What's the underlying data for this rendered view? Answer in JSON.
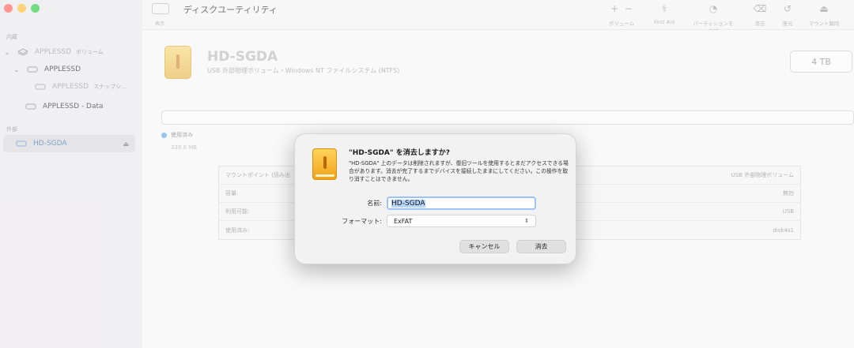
{
  "window": {
    "title": "ディスクユーティリティ",
    "view_label": "表示"
  },
  "toolbar": {
    "buttons": [
      {
        "label": "ボリューム",
        "icon": "plus-minus-icon"
      },
      {
        "label": "First Aid",
        "icon": "stethoscope-icon"
      },
      {
        "label": "パーティションを作成",
        "icon": "partition-icon"
      },
      {
        "label": "消去",
        "icon": "erase-icon"
      },
      {
        "label": "復元",
        "icon": "restore-icon"
      },
      {
        "label": "マウント解除",
        "icon": "eject-icon"
      }
    ]
  },
  "sidebar": {
    "section_internal": "内蔵",
    "section_external": "外部",
    "items": [
      {
        "label": "APPLESSD",
        "sub": "ボリューム"
      },
      {
        "label": "APPLESSD",
        "sub": ""
      },
      {
        "label": "APPLESSD",
        "sub": "スナップシ…"
      },
      {
        "label": "APPLESSD - Data",
        "sub": ""
      },
      {
        "label": "HD-SGDA",
        "sub": ""
      }
    ]
  },
  "main": {
    "disk_name": "HD-SGDA",
    "disk_desc": "USB 外部物理ボリューム・Windows NT ファイルシステム (NTFS)",
    "capacity": "4 TB",
    "used_label": "使用済み",
    "used_value": "339.6 MB",
    "info_rows": [
      {
        "left": "マウントポイント (読み出",
        "right": "USB 外部物理ボリューム"
      },
      {
        "left": "容量:",
        "right": "無効"
      },
      {
        "left": "利用可能:",
        "right": "USB"
      },
      {
        "left": "使用済み:",
        "right": "disk4s1"
      }
    ]
  },
  "dialog": {
    "title": "\"HD-SGDA\" を消去しますか?",
    "message": "\"HD-SGDA\" 上のデータは削除されますが、復旧ツールを使用するとまだアクセスできる場合があります。消去が完了するまでデバイスを接続したままにしてください。この操作を取り消すことはできません。",
    "name_label": "名前:",
    "name_value": "HD-SGDA",
    "format_label": "フォーマット:",
    "format_value": "ExFAT",
    "cancel_label": "キャンセル",
    "erase_label": "消去"
  },
  "colors": {
    "accent": "#5aa7e6",
    "focus_ring": "#9cc3f5",
    "selection": "#b7d5fb"
  }
}
